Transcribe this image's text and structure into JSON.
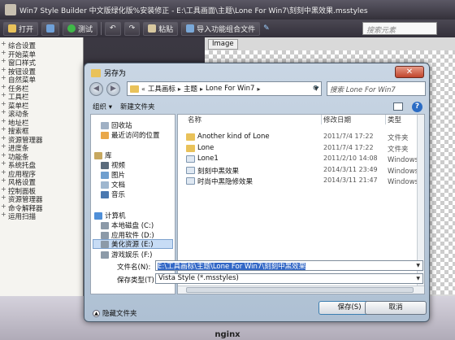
{
  "app": {
    "title": "Win7 Style Builder 中文版绿化版%安装修正 - E:\\工具画面\\主题\\Lone For Win7\\刻刻中黑效果.msstyles",
    "toolbar": {
      "open": "打开",
      "test": "测试",
      "paste": "粘贴",
      "import": "导入功能组合文件",
      "search_placeholder": "搜索元素"
    },
    "tree_items": [
      "综合设置",
      "开始菜单",
      "窗口样式",
      "按钮设置",
      "自然菜单",
      "任务栏",
      "工具栏",
      "菜单栏",
      "滚动条",
      "地址栏",
      "搜索框",
      "资源管理器",
      "进度条",
      "功能条",
      "系统托盘",
      "应用程序",
      "风格设置",
      "控制面板",
      "资源管理器",
      "命令解释器",
      "运用扫描"
    ],
    "image_tab": "Image",
    "footer": "nginx"
  },
  "dialog": {
    "title": "另存为",
    "close": "✕",
    "address": {
      "crumbs": [
        "工具画标",
        "主题",
        "Lone For Win7"
      ],
      "search_placeholder": "搜索 Lone For Win7"
    },
    "commands": {
      "organize": "组织 ▾",
      "new_folder": "新建文件夹"
    },
    "nav": {
      "recycle": "回收站",
      "recent": "最近访问的位置",
      "libraries": "库",
      "videos": "视频",
      "pictures": "图片",
      "documents": "文档",
      "music": "音乐",
      "computer": "计算机",
      "drive_c": "本地磁盘 (C:)",
      "drive_d": "应用软件 (D:)",
      "drive_e": "美化资源 (E:)",
      "drive_f": "游戏娱乐 (F:)"
    },
    "columns": {
      "name": "名称",
      "date": "修改日期",
      "type": "类型"
    },
    "files": [
      {
        "name": "Another kind of Lone",
        "date": "2011/7/4 17:22",
        "type": "文件夹",
        "kind": "folder"
      },
      {
        "name": "Lone",
        "date": "2011/7/4 17:22",
        "type": "文件夹",
        "kind": "folder"
      },
      {
        "name": "Lone1",
        "date": "2011/2/10 14:08",
        "type": "Windows 视觉",
        "kind": "style"
      },
      {
        "name": "刻刻中黑效果",
        "date": "2014/3/11 23:49",
        "type": "Windows 视觉",
        "kind": "style"
      },
      {
        "name": "时尚中黑隐修效果",
        "date": "2014/3/11 21:47",
        "type": "Windows 视觉",
        "kind": "style"
      }
    ],
    "filename_label": "文件名(N):",
    "filename_value": "E:\\工具画标\\主题\\Lone For Win7\\刻刻中黑效果",
    "filetype_label": "保存类型(T):",
    "filetype_value": "Vista Style (*.msstyles)",
    "hide_folders": "隐藏文件夹",
    "save": "保存(S)",
    "cancel": "取消",
    "colors": {
      "folder": "#e9c25a",
      "selection": "#3267c6"
    }
  }
}
